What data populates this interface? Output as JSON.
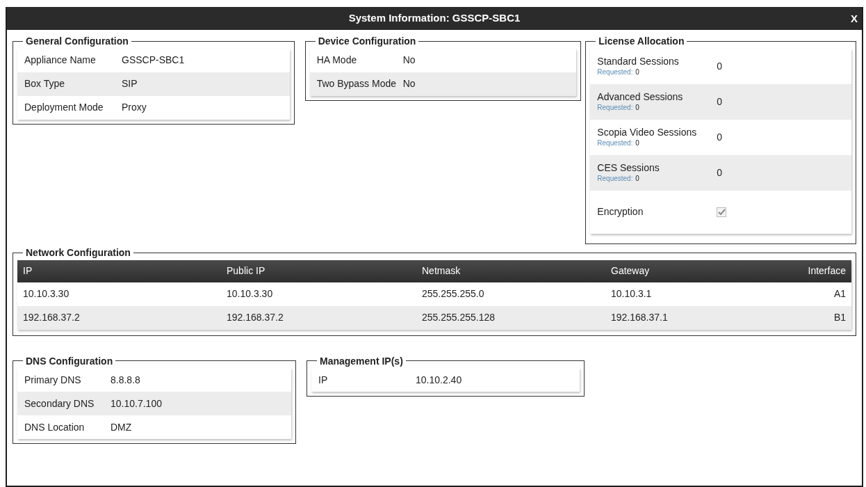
{
  "window": {
    "title": "System Information: GSSCP-SBC1",
    "close_label": "X"
  },
  "general_configuration": {
    "title": "General Configuration",
    "rows": [
      {
        "label": "Appliance Name",
        "value": "GSSCP-SBC1"
      },
      {
        "label": "Box Type",
        "value": "SIP"
      },
      {
        "label": "Deployment Mode",
        "value": "Proxy"
      }
    ]
  },
  "device_configuration": {
    "title": "Device Configuration",
    "rows": [
      {
        "label": "HA Mode",
        "value": "No"
      },
      {
        "label": "Two Bypass Mode",
        "value": "No"
      }
    ]
  },
  "license_allocation": {
    "title": "License Allocation",
    "rows": [
      {
        "kind": "session",
        "label": "Standard Sessions",
        "requested_label": "Requested:",
        "requested_value": "0",
        "value": "0"
      },
      {
        "kind": "session",
        "label": "Advanced Sessions",
        "requested_label": "Requested:",
        "requested_value": "0",
        "value": "0"
      },
      {
        "kind": "session",
        "label": "Scopia Video Sessions",
        "requested_label": "Requested:",
        "requested_value": "0",
        "value": "0"
      },
      {
        "kind": "session",
        "label": "CES Sessions",
        "requested_label": "Requested:",
        "requested_value": "0",
        "value": "0"
      },
      {
        "kind": "checkbox",
        "label": "Encryption",
        "checked": true
      }
    ]
  },
  "network_configuration": {
    "title": "Network Configuration",
    "columns": [
      "IP",
      "Public IP",
      "Netmask",
      "Gateway",
      "Interface"
    ],
    "rows": [
      [
        "10.10.3.30",
        "10.10.3.30",
        "255.255.255.0",
        "10.10.3.1",
        "A1"
      ],
      [
        "192.168.37.2",
        "192.168.37.2",
        "255.255.255.128",
        "192.168.37.1",
        "B1"
      ]
    ]
  },
  "dns_configuration": {
    "title": "DNS Configuration",
    "rows": [
      {
        "label": "Primary DNS",
        "value": "8.8.8.8"
      },
      {
        "label": "Secondary DNS",
        "value": "10.10.7.100"
      },
      {
        "label": "DNS Location",
        "value": "DMZ"
      }
    ]
  },
  "management_ips": {
    "title": "Management IP(s)",
    "rows": [
      {
        "label": "IP",
        "value": "10.10.2.40"
      }
    ]
  }
}
